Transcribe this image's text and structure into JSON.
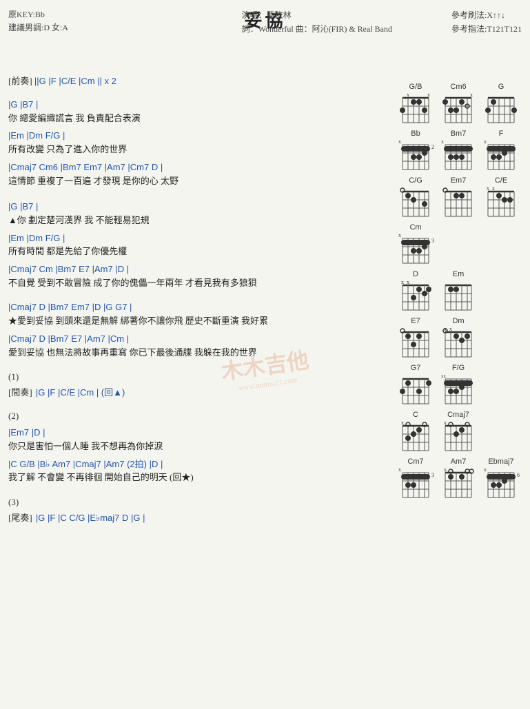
{
  "title": "妥協",
  "meta": {
    "key": "原KEY:Bb",
    "suggested_key": "建議男調:D 女:A",
    "singer": "演唱：蔡依林",
    "lyricist": "詞：Wonderful  曲：阿沁(FIR) & Real Band",
    "strum": "參考刷法:X↑↑↓",
    "fingering": "參考指法:T121T121"
  },
  "sections": {
    "intro_label": "[前奏]",
    "intro_chords": "||G  |F  |C/E  |Cm  || x 2",
    "verse1_chords1": "|G                    |B7                  |",
    "verse1_lyric1": "你   總愛編織謊言  我   負責配合表演",
    "verse1_chords2": "|Em         |Dm        F/G   |",
    "verse1_lyric2": "所有改變  只為了進入你的世界",
    "verse1_chords3": "|Cmaj7  Cm6   |Bm7  Em7  |Am7              |Cm7  D   |",
    "verse1_lyric3": "這情節      重複了一百遍              才發現   是你的心   太野",
    "verse2_chords1": "|G                    |B7                  |",
    "verse2_lyric1": "▲你    劃定楚河漢界  我   不能輕易犯規",
    "verse2_chords2": "|Em         |Dm        F/G   |",
    "verse2_lyric2": "所有時間   都是先給了你優先權",
    "verse2_chords3": "|Cmaj7  Cm   |Bm7  E7   |Am7                         |D         |",
    "verse2_lyric3": "不自覺      受到不敢冒險  成了你的傀儡一年兩年    才看見我有多狼狽",
    "chorus1_chords1": "          |Cmaj7   D           |Bm7      Em7       |D              |G  G7   |",
    "chorus1_lyric1": "★愛到妥協  到頭來還是無解  綁著你不讓你飛  歷史不斷重演  我好累",
    "chorus1_chords2": "          |Cmaj7   D           |Bm7  E7  |Am7              |Cm         |",
    "chorus1_lyric2": "愛到妥協  也無法將故事再重寫  你已下最後通牒  我躲在我的世界",
    "section1_label": "(1)",
    "interlude1_label": "[間奏]",
    "interlude1_chords": "|G  |F  |C/E  |Cm  |  (回▲)",
    "section2_label": "(2)",
    "section2_chords1": "|Em7                          |D                   |",
    "section2_lyric1": "你只是害怕一個人睡  我不想再為你掉淚",
    "section2_chords2": "|C   G/B  |B♭  Am7       |Cmaj7    |Am7 (2拍)  |D    |",
    "section2_lyric2": "我了解      不會變   不再徘徊    開始自己的明天         (回★)",
    "section3_label": "(3)",
    "outro_label": "[尾奏]",
    "outro_chords": "|G  |F  |C   C/G  |E♭maj7  D  |G   |"
  },
  "chord_diagrams": [
    {
      "row": 1,
      "chords": [
        {
          "name": "G/B",
          "fret_offset": ""
        },
        {
          "name": "Cm6",
          "fret_offset": ""
        },
        {
          "name": "G",
          "fret_offset": ""
        }
      ]
    },
    {
      "row": 2,
      "chords": [
        {
          "name": "Bb",
          "fret_offset": "2"
        },
        {
          "name": "Bm7",
          "fret_offset": ""
        },
        {
          "name": "F",
          "fret_offset": ""
        }
      ]
    },
    {
      "row": 3,
      "chords": [
        {
          "name": "C/G",
          "fret_offset": ""
        },
        {
          "name": "Em7",
          "fret_offset": ""
        },
        {
          "name": "C/E",
          "fret_offset": ""
        }
      ]
    },
    {
      "row": 4,
      "chords": [
        {
          "name": "Cm",
          "fret_offset": "3"
        }
      ]
    },
    {
      "row": 5,
      "chords": [
        {
          "name": "D",
          "fret_offset": ""
        },
        {
          "name": "Em",
          "fret_offset": ""
        }
      ]
    },
    {
      "row": 6,
      "chords": [
        {
          "name": "E7",
          "fret_offset": ""
        },
        {
          "name": "Dm",
          "fret_offset": ""
        }
      ]
    },
    {
      "row": 7,
      "chords": [
        {
          "name": "G7",
          "fret_offset": ""
        },
        {
          "name": "F/G",
          "fret_offset": ""
        }
      ]
    },
    {
      "row": 8,
      "chords": [
        {
          "name": "C",
          "fret_offset": ""
        },
        {
          "name": "Cmaj7",
          "fret_offset": ""
        }
      ]
    },
    {
      "row": 9,
      "chords": [
        {
          "name": "Cm7",
          "fret_offset": "3"
        },
        {
          "name": "Am7",
          "fret_offset": ""
        },
        {
          "name": "Ebmaj7",
          "fret_offset": "6"
        }
      ]
    }
  ],
  "watermark": "木木吉他",
  "watermark_sub": "www.mumu21.com"
}
